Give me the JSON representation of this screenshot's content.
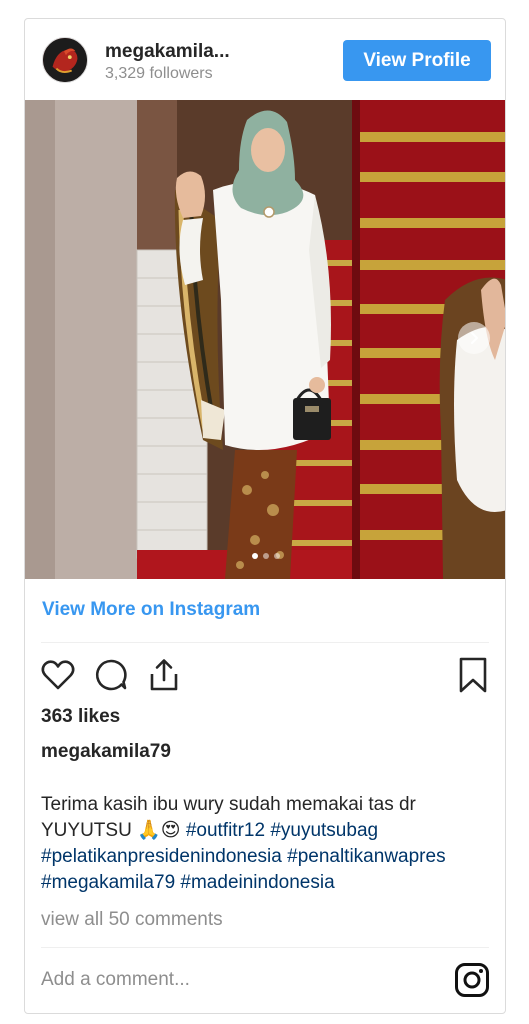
{
  "header": {
    "username": "megakamila...",
    "followers": "3,329 followers",
    "view_profile_label": "View Profile"
  },
  "post": {
    "carousel": {
      "total": 3,
      "active": 1
    },
    "view_more_label": "View More on Instagram",
    "likes": "363 likes",
    "owner": "megakamila79",
    "caption": {
      "line1": "Terima kasih ibu wury sudah memakai tas dr",
      "line2_text": "YUYUTSU ",
      "line2_emoji": "🙏😍",
      "line2_tags": "#outfitr12 #yuyutsubag",
      "line3": "#pelatikanpresidenindonesia #penaltikanwapres",
      "line4": "#megakamila79 #madeinindonesia"
    },
    "view_comments_label": "view all 50 comments",
    "add_comment_placeholder": "Add a comment..."
  },
  "icons": [
    "heart-icon",
    "comment-icon",
    "share-icon",
    "bookmark-icon",
    "instagram-icon",
    "chevron-right-icon"
  ],
  "colors": {
    "accent": "#3897f0",
    "hashtag": "#003569",
    "muted": "#8e8e8e"
  }
}
